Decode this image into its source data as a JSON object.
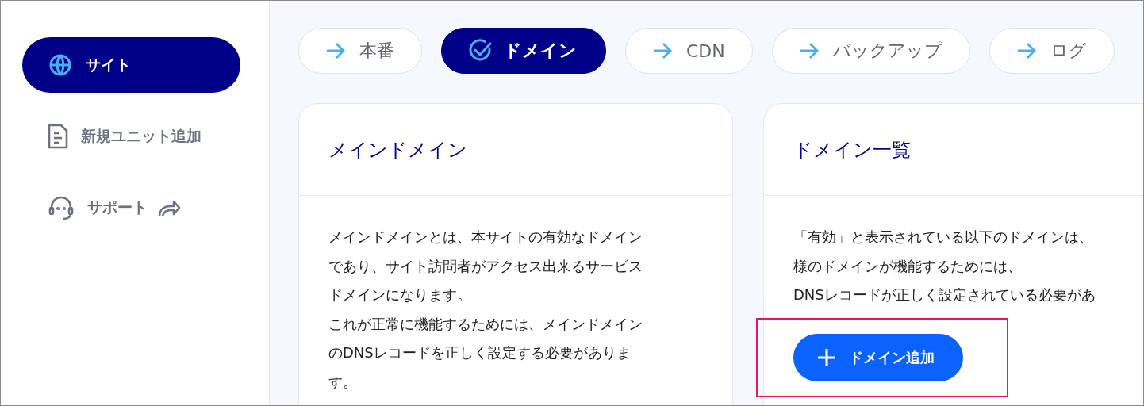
{
  "sidebar": {
    "items": [
      {
        "label": "サイト",
        "selected": true
      },
      {
        "label": "新規ユニット追加",
        "selected": false
      },
      {
        "label": "サポート",
        "selected": false,
        "external": true
      }
    ]
  },
  "tabs": [
    {
      "label": "本番",
      "selected": false
    },
    {
      "label": "ドメイン",
      "selected": true
    },
    {
      "label": "CDN",
      "selected": false
    },
    {
      "label": "バックアップ",
      "selected": false
    },
    {
      "label": "ログ",
      "selected": false
    }
  ],
  "cards": [
    {
      "title": "メインドメイン",
      "lines": [
        "メインドメインとは、本サイトの有効なドメイン",
        "であり、サイト訪問者がアクセス出来るサービス",
        "ドメインになります。",
        "これが正常に機能するためには、メインドメイン",
        "のDNSレコードを正しく設定する必要がありま",
        "す。"
      ]
    },
    {
      "title": "ドメイン一覧",
      "lines": [
        "「有効」と表示されている以下のドメインは、",
        "様のドメインが機能するためには、",
        "DNSレコードが正しく設定されている必要があ"
      ],
      "button": {
        "label": "ドメイン追加",
        "highlighted": true
      }
    }
  ]
}
